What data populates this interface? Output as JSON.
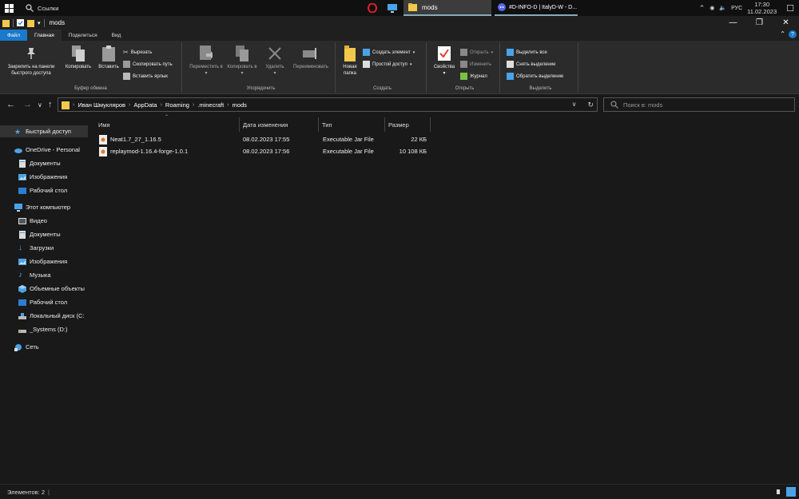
{
  "taskbar": {
    "search_label": "Ссылки",
    "mods_label": "mods",
    "discord_label": "#D-INFO-D | ItalyD-W - D...",
    "lang": "РУС",
    "time": "17:30",
    "date": "11.02.2023"
  },
  "window": {
    "title": "mods"
  },
  "ribbon_tabs": [
    "Файл",
    "Главная",
    "Поделиться",
    "Вид"
  ],
  "ribbon": {
    "clipboard": {
      "pin": "Закрепить на панели быстрого доступа",
      "copy": "Копировать",
      "paste": "Вставить",
      "cut": "Вырезать",
      "copy_path": "Скопировать путь",
      "paste_shortcut": "Вставить ярлык",
      "label": "Буфер обмена"
    },
    "organize": {
      "move": "Переместить в",
      "copy_to": "Копировать в",
      "delete": "Удалить",
      "rename": "Переименовать",
      "label": "Упорядочить"
    },
    "create": {
      "new_folder": "Новая папка",
      "new_item": "Создать элемент",
      "easy_access": "Простой доступ",
      "label": "Создать"
    },
    "open": {
      "properties": "Свойства",
      "open": "Открыть",
      "edit": "Изменить",
      "history": "Журнал",
      "label": "Открыть"
    },
    "select": {
      "select_all": "Выделить все",
      "select_none": "Снять выделение",
      "invert": "Обратить выделение",
      "label": "Выделить"
    }
  },
  "address": {
    "crumbs": [
      "Иван Шмукляров",
      "AppData",
      "Roaming",
      ".minecraft",
      "mods"
    ],
    "search_placeholder": "Поиск в: mods"
  },
  "nav": {
    "quick_access": "Быстрый доступ",
    "onedrive": "OneDrive - Personal",
    "od_documents": "Документы",
    "od_images": "Изображения",
    "od_desktop": "Рабочий стол",
    "this_pc": "Этот компьютер",
    "video": "Видео",
    "documents": "Документы",
    "downloads": "Загрузки",
    "images": "Изображения",
    "music": "Музыка",
    "objects3d": "Объемные объекты",
    "desktop": "Рабочий стол",
    "local_disk": "Локальный диск (C:",
    "systems": "_Systems (D:)",
    "network": "Сеть"
  },
  "columns": {
    "name": "Имя",
    "modified": "Дата изменения",
    "type": "Тип",
    "size": "Размер"
  },
  "files": [
    {
      "name": "Neat1.7_27_1.16.5",
      "modified": "08.02.2023 17:55",
      "type": "Executable Jar File",
      "size": "22 КБ"
    },
    {
      "name": "replaymod-1.16.4-forge-1.0.1",
      "modified": "08.02.2023 17:56",
      "type": "Executable Jar File",
      "size": "10 108 КБ"
    }
  ],
  "status": {
    "items": "Элементов: 2"
  },
  "colors": {
    "accent": "#1979ca",
    "folder": "#f2c94c",
    "background": "#191919",
    "ribbon": "#2b2b2b"
  }
}
